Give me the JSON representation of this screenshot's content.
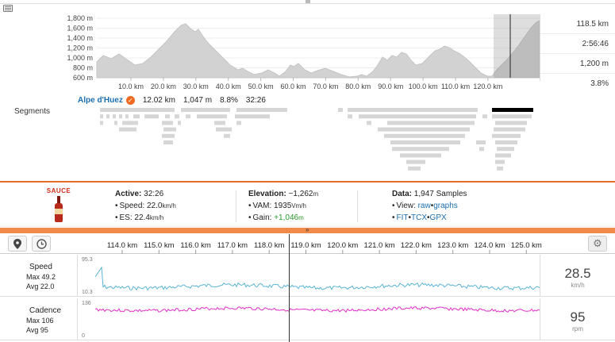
{
  "elevation": {
    "y_ticks": [
      "1,800 m",
      "1,600 m",
      "1,400 m",
      "1,200 m",
      "1,000 m",
      "800 m",
      "600 m"
    ],
    "x_ticks": [
      "10.0 km",
      "20.0 km",
      "30.0 km",
      "40.0 km",
      "50.0 km",
      "60.0 km",
      "70.0 km",
      "80.0 km",
      "90.0 km",
      "100.0 km",
      "110.0 km",
      "120.0 km"
    ]
  },
  "stats": [
    "118.5 km",
    "2:56:46",
    "1,200 m",
    "3.8%"
  ],
  "segment": {
    "name": "Alpe d'Huez",
    "badge": "✓",
    "distance": "12.02 km",
    "elevation": "1,047 m",
    "grade": "8.8%",
    "time": "32:26"
  },
  "segments_label": "Segments",
  "info": {
    "logo": "SAUCE",
    "active": {
      "label": "Active:",
      "value": "32:26"
    },
    "speed": {
      "label": "Speed:",
      "value": "22.0",
      "unit": "km/h"
    },
    "es": {
      "label": "ES:",
      "value": "22.4",
      "unit": "km/h"
    },
    "elevation": {
      "label": "Elevation:",
      "value": "~1,262",
      "unit": "m"
    },
    "vam": {
      "label": "VAM:",
      "value": "1935",
      "unit": "Vm/h"
    },
    "gain": {
      "label": "Gain:",
      "value": "+1,046",
      "unit": "m"
    },
    "data": {
      "label": "Data:",
      "value": "1,947 Samples"
    },
    "view": {
      "label": "View:",
      "raw": "raw",
      "sep": "•",
      "graphs": "graphs"
    },
    "exports": {
      "fit": "FIT",
      "tcx": "TCX",
      "gpx": "GPX",
      "sep": "•"
    }
  },
  "expand_glyph": "»",
  "timeline": {
    "ticks": [
      "114.0 km",
      "115.0 km",
      "116.0 km",
      "117.0 km",
      "118.0 km",
      "119.0 km",
      "120.0 km",
      "121.0 km",
      "122.0 km",
      "123.0 km",
      "124.0 km",
      "125.0 km"
    ]
  },
  "streams": [
    {
      "name": "Speed",
      "max": "Max 49.2",
      "avg": "Avg 22.0",
      "ymax": "95.3",
      "ymin": "10.3",
      "current": "28.5",
      "unit": "km/h",
      "color": "#5ab4d4"
    },
    {
      "name": "Cadence",
      "max": "Max 106",
      "avg": "Avg 95",
      "ymax": "136",
      "ymin": "0",
      "current": "95",
      "unit": "rpm",
      "color": "#e030c8"
    }
  ],
  "colors": {
    "accent": "#e86a2c",
    "link": "#1a6fb0"
  },
  "icons": [
    "keyboard-icon",
    "map-pin-icon",
    "clock-icon",
    "gear-icon",
    "verified-badge-icon",
    "sauce-bottle-icon"
  ]
}
